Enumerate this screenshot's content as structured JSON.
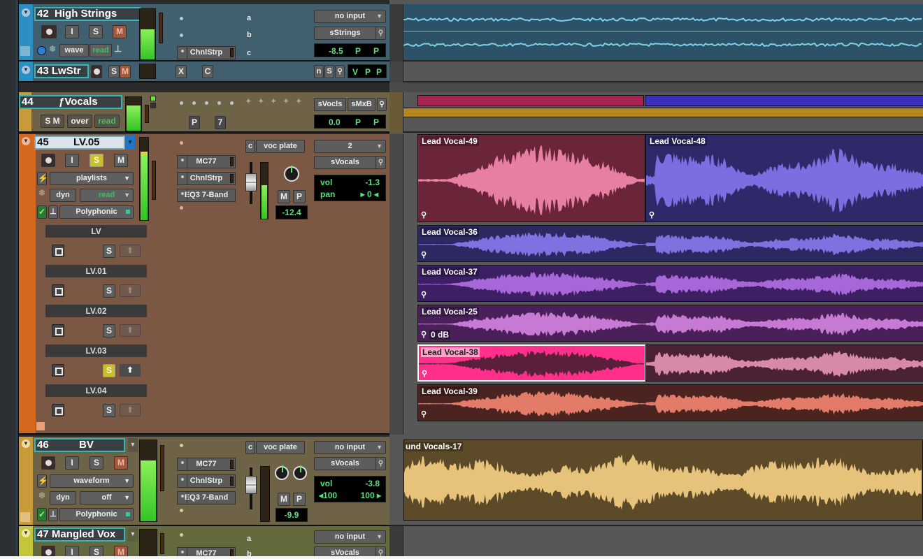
{
  "tracks": {
    "t42": {
      "number": "42",
      "name": "High Strings",
      "color": "#2a8ec2",
      "buttons": {
        "rec": "",
        "input": "I",
        "solo": "S",
        "mute": "M"
      },
      "view": "wave",
      "automation": "read",
      "inserts": [
        "",
        "",
        "ChnlStrp"
      ],
      "sends": [
        "a",
        "b",
        "c"
      ],
      "input": "no input",
      "output": "sStrings",
      "volume": "-8.5",
      "pan_l": "P",
      "pan_r": "P",
      "meter_level": 0.7
    },
    "t43": {
      "number": "43",
      "name": "LwStr",
      "color": "#2a8ec2",
      "buttons": {
        "solo": "S",
        "mute": "M"
      },
      "inserts": [
        "X",
        "C"
      ],
      "mini": {
        "n": "n",
        "s": "S"
      },
      "lcd": [
        "V",
        "P",
        "P"
      ],
      "meter_level": 0.0
    },
    "t44": {
      "number": "44",
      "name": "ƒVocals",
      "color": "#c89a3a",
      "buttons": {
        "solo": "S",
        "mute": "M"
      },
      "mode": "over",
      "automation": "read",
      "vca_labels": [
        "P",
        "7"
      ],
      "output_a": "sVocls",
      "output_b": "sMxB",
      "volume": "0.0",
      "pan_l": "P",
      "pan_r": "P",
      "meter_level": 0.75
    },
    "t45": {
      "number": "45",
      "name": "LV.05",
      "color": "#d4681f",
      "buttons": {
        "rec": "",
        "input": "I",
        "solo": "S",
        "mute": "M"
      },
      "view": "playlists",
      "dyn": "dyn",
      "automation": "read",
      "elastic": "Polyphonic",
      "inserts": [
        "MC77",
        "ChnlStrp",
        "EQ3 7-Band"
      ],
      "send_prefix": "c",
      "send": "voc plate",
      "input": "2",
      "output": "sVocals",
      "send_m": "M",
      "send_p": "P",
      "send_level": "-12.4",
      "vol_label": "vol",
      "volume": "-1.3",
      "pan_label": "pan",
      "pan": "0",
      "meter_level": 0.9,
      "playlists": [
        {
          "name": "LV",
          "solo": "S",
          "solo_on": false,
          "up_on": false
        },
        {
          "name": "LV.01",
          "solo": "S",
          "solo_on": false,
          "up_on": false
        },
        {
          "name": "LV.02",
          "solo": "S",
          "solo_on": false,
          "up_on": false
        },
        {
          "name": "LV.03",
          "solo": "S",
          "solo_on": true,
          "up_on": true
        },
        {
          "name": "LV.04",
          "solo": "S",
          "solo_on": false,
          "up_on": false
        }
      ]
    },
    "t46": {
      "number": "46",
      "name": "BV",
      "color": "#c89a3a",
      "buttons": {
        "rec": "",
        "input": "I",
        "solo": "S",
        "mute": "M"
      },
      "view": "waveform",
      "dyn": "dyn",
      "automation": "off",
      "elastic": "Polyphonic",
      "inserts": [
        "MC77",
        "ChnlStrp",
        "EQ3 7-Band"
      ],
      "send_prefix": "c",
      "send": "voc plate",
      "input": "no input",
      "output": "sVocals",
      "send_m": "M",
      "send_p": "P",
      "send_level": "-9.9",
      "vol_label": "vol",
      "volume": "-3.8",
      "pan_l": "100",
      "pan_r": "100",
      "meter_level": 0.75
    },
    "t47": {
      "number": "47",
      "name": "Mangled Vox",
      "color": "#c5c53a",
      "buttons": {
        "rec": "",
        "input": "I",
        "solo": "S",
        "mute": "M"
      },
      "inserts": [
        "",
        "MC77"
      ],
      "sends": [
        "a",
        "b"
      ],
      "input": "no input",
      "output": "sVocals",
      "meter_level": 0.1
    }
  },
  "edit": {
    "regions": [
      {
        "name": "Lead Vocal-49",
        "lane": "main",
        "color": "#6b2538",
        "wave": "#e77fa3"
      },
      {
        "name": "Lead Vocal-48",
        "lane": "main",
        "color": "#2e2a6a",
        "wave": "#7c6ee0"
      },
      {
        "name": "Lead Vocal-36",
        "lane": "pl1",
        "color": "#2b2862",
        "wave": "#7e72e0"
      },
      {
        "name": "Lead Vocal-37",
        "lane": "pl2",
        "color": "#3d1f63",
        "wave": "#a867d8"
      },
      {
        "name": "Lead Vocal-25",
        "lane": "pl3",
        "color": "#4a1f5a",
        "wave": "#c77ad3",
        "gain": "0 dB"
      },
      {
        "name": "Lead Vocal-38",
        "lane": "pl4",
        "color": "#ff2f8a",
        "wave": "#5a1f3a",
        "selected": true,
        "continuation": "#d78aa8"
      },
      {
        "name": "Lead Vocal-39",
        "lane": "pl5",
        "color": "#4b2421",
        "wave": "#e27c68"
      },
      {
        "name": "und Vocals-17",
        "lane": "bv",
        "color": "#5c4a28",
        "wave": "#e7c27a"
      }
    ],
    "fvocals_bars": [
      {
        "color": "#a8234f"
      },
      {
        "color": "#3b2fc0"
      }
    ],
    "group_bar_color": "#b7861f"
  }
}
